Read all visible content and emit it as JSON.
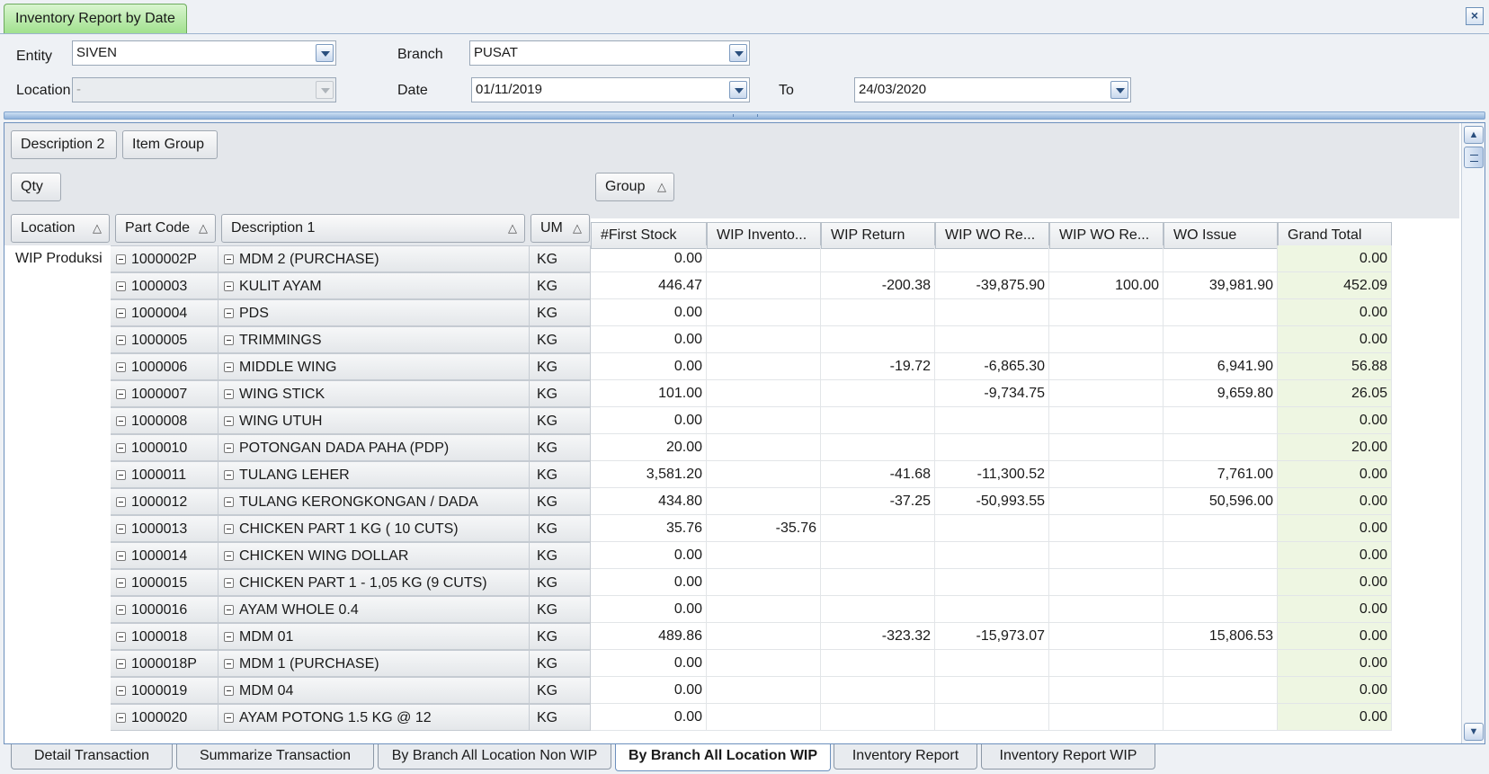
{
  "window": {
    "tab_title": "Inventory Report by Date",
    "close_label": "×"
  },
  "filters": {
    "entity_label": "Entity",
    "entity_value": "SIVEN",
    "branch_label": "Branch",
    "branch_value": "PUSAT",
    "location_label": "Location",
    "location_value": "-",
    "date_label": "Date",
    "date_value": "01/11/2019",
    "to_label": "To",
    "to_value": "24/03/2020"
  },
  "pivot": {
    "filter_fields": [
      "Description 2",
      "Item Group"
    ],
    "data_field": "Qty",
    "column_field": "Group",
    "row_fields": [
      "Location",
      "Part Code",
      "Description 1",
      "UM"
    ],
    "sort_glyph": "△",
    "columns": [
      "#First Stock",
      "WIP Invento...",
      "WIP Return",
      "WIP WO Re...",
      "WIP WO Re...",
      "WO Issue",
      "Grand Total"
    ],
    "location": "WIP Produksi",
    "rows": [
      {
        "code": "1000002P",
        "desc": "MDM 2 (PURCHASE)",
        "um": "KG",
        "v": [
          "0.00",
          "",
          "",
          "",
          "",
          "",
          "0.00"
        ]
      },
      {
        "code": "1000003",
        "desc": "KULIT AYAM",
        "um": "KG",
        "v": [
          "446.47",
          "",
          "-200.38",
          "-39,875.90",
          "100.00",
          "39,981.90",
          "452.09"
        ]
      },
      {
        "code": "1000004",
        "desc": "PDS",
        "um": "KG",
        "v": [
          "0.00",
          "",
          "",
          "",
          "",
          "",
          "0.00"
        ]
      },
      {
        "code": "1000005",
        "desc": "TRIMMINGS",
        "um": "KG",
        "v": [
          "0.00",
          "",
          "",
          "",
          "",
          "",
          "0.00"
        ]
      },
      {
        "code": "1000006",
        "desc": "MIDDLE WING",
        "um": "KG",
        "v": [
          "0.00",
          "",
          "-19.72",
          "-6,865.30",
          "",
          "6,941.90",
          "56.88"
        ]
      },
      {
        "code": "1000007",
        "desc": "WING STICK",
        "um": "KG",
        "v": [
          "101.00",
          "",
          "",
          "-9,734.75",
          "",
          "9,659.80",
          "26.05"
        ]
      },
      {
        "code": "1000008",
        "desc": "WING UTUH",
        "um": "KG",
        "v": [
          "0.00",
          "",
          "",
          "",
          "",
          "",
          "0.00"
        ]
      },
      {
        "code": "1000010",
        "desc": "POTONGAN DADA PAHA (PDP)",
        "um": "KG",
        "v": [
          "20.00",
          "",
          "",
          "",
          "",
          "",
          "20.00"
        ]
      },
      {
        "code": "1000011",
        "desc": "TULANG LEHER",
        "um": "KG",
        "v": [
          "3,581.20",
          "",
          "-41.68",
          "-11,300.52",
          "",
          "7,761.00",
          "0.00"
        ]
      },
      {
        "code": "1000012",
        "desc": "TULANG KERONGKONGAN / DADA",
        "um": "KG",
        "v": [
          "434.80",
          "",
          "-37.25",
          "-50,993.55",
          "",
          "50,596.00",
          "0.00"
        ]
      },
      {
        "code": "1000013",
        "desc": "CHICKEN PART 1 KG ( 10 CUTS)",
        "um": "KG",
        "v": [
          "35.76",
          "-35.76",
          "",
          "",
          "",
          "",
          "0.00"
        ]
      },
      {
        "code": "1000014",
        "desc": "CHICKEN WING DOLLAR",
        "um": "KG",
        "v": [
          "0.00",
          "",
          "",
          "",
          "",
          "",
          "0.00"
        ]
      },
      {
        "code": "1000015",
        "desc": "CHICKEN PART 1 - 1,05 KG (9 CUTS)",
        "um": "KG",
        "v": [
          "0.00",
          "",
          "",
          "",
          "",
          "",
          "0.00"
        ]
      },
      {
        "code": "1000016",
        "desc": "AYAM WHOLE 0.4",
        "um": "KG",
        "v": [
          "0.00",
          "",
          "",
          "",
          "",
          "",
          "0.00"
        ]
      },
      {
        "code": "1000018",
        "desc": "MDM 01",
        "um": "KG",
        "v": [
          "489.86",
          "",
          "-323.32",
          "-15,973.07",
          "",
          "15,806.53",
          "0.00"
        ]
      },
      {
        "code": "1000018P",
        "desc": "MDM 1 (PURCHASE)",
        "um": "KG",
        "v": [
          "0.00",
          "",
          "",
          "",
          "",
          "",
          "0.00"
        ]
      },
      {
        "code": "1000019",
        "desc": "MDM 04",
        "um": "KG",
        "v": [
          "0.00",
          "",
          "",
          "",
          "",
          "",
          "0.00"
        ]
      },
      {
        "code": "1000020",
        "desc": "AYAM POTONG 1.5 KG @ 12",
        "um": "KG",
        "v": [
          "0.00",
          "",
          "",
          "",
          "",
          "",
          "0.00"
        ]
      }
    ]
  },
  "bottom_tabs": [
    {
      "label": "Detail Transaction",
      "active": false
    },
    {
      "label": "Summarize Transaction",
      "active": false
    },
    {
      "label": "By Branch All Location Non WIP",
      "active": false
    },
    {
      "label": "By Branch All Location WIP",
      "active": true
    },
    {
      "label": "Inventory Report",
      "active": false
    },
    {
      "label": "Inventory Report WIP",
      "active": false
    }
  ]
}
